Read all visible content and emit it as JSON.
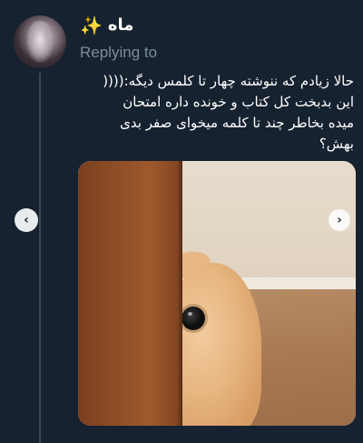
{
  "tweet": {
    "author_name": "ماه",
    "author_emoji": "✨",
    "replying_label": "Replying to",
    "text_lines": [
      "حالا زیادم که ننوشته چهار تا کلمس دیگه:((((",
      "این بدبخت کل کتاب و خونده داره امتحان",
      "میده بخاطر چند تا کلمه میخوای صفر بدی",
      "بهش؟"
    ]
  },
  "media": {
    "icon": "photo-cat-peeking-behind-door"
  },
  "carousel": {
    "prev_icon": "‹",
    "next_icon": "›"
  }
}
